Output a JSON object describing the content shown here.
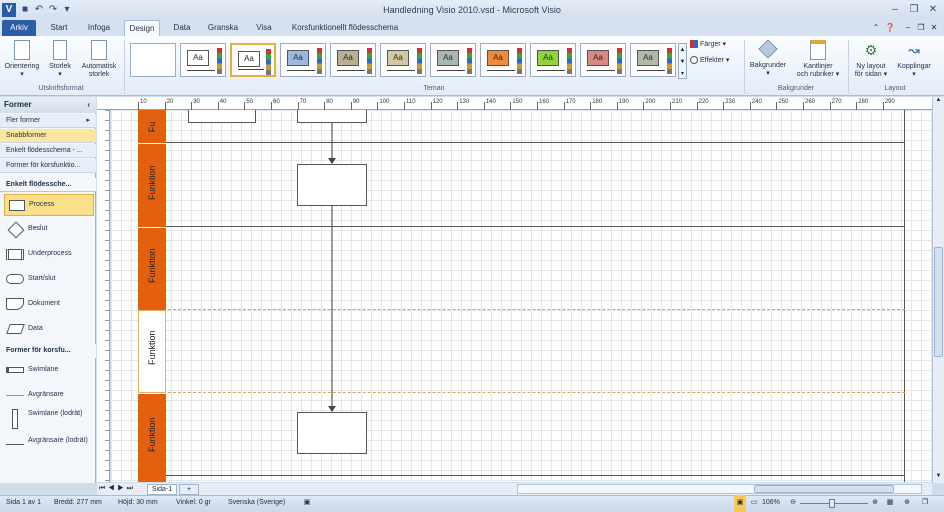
{
  "window": {
    "title": "Handledning Visio 2010.vsd - Microsoft Visio"
  },
  "tabs": [
    {
      "label": "Arkiv"
    },
    {
      "label": "Start"
    },
    {
      "label": "Infoga"
    },
    {
      "label": "Design"
    },
    {
      "label": "Data"
    },
    {
      "label": "Granska"
    },
    {
      "label": "Visa"
    },
    {
      "label": "Korsfunktionellt flödesschema"
    }
  ],
  "ribbon": {
    "page_setup": {
      "orientation": "Orientering",
      "size": "Storlek",
      "auto_size_1": "Automatisk",
      "auto_size_2": "storlek",
      "group": "Utskriftsformat"
    },
    "themes": {
      "group": "Teman",
      "colors": "Färger",
      "effects": "Effekter",
      "labels": [
        "Aa",
        "Aa",
        "Aa",
        "Aa",
        "Aa",
        "Aa",
        "Aa",
        "Aa",
        "Aa",
        "Aa",
        "Aa"
      ]
    },
    "backgrounds": {
      "bg": "Bakgrunder",
      "borders_1": "Kantlinjer",
      "borders_2": "och rubriker",
      "group": "Bakgrunder"
    },
    "layout": {
      "relayout_1": "Ny layout",
      "relayout_2": "för sidan",
      "connectors": "Kopplingar",
      "group": "Layout"
    }
  },
  "panel": {
    "title": "Former",
    "items": [
      "Fler former",
      "Snabbformer",
      "Enkelt flödesschema - ...",
      "Former för korsfunktio...",
      "Enkelt flödessche..."
    ],
    "shapes": [
      "Process",
      "Beslut",
      "Underprocess",
      "Start/slut",
      "Dokument",
      "Data"
    ],
    "section2": "Former för korsfu...",
    "shapes2": [
      "Swimlane",
      "Avgränsare",
      "Swimlane (lodrät)",
      "Avgränsare (lodrät)"
    ]
  },
  "ruler_ticks": [
    "10",
    "20",
    "30",
    "40",
    "50",
    "60",
    "70",
    "80",
    "90",
    "100",
    "110",
    "120",
    "130",
    "140",
    "150",
    "160",
    "170",
    "180",
    "190",
    "200",
    "210",
    "220",
    "230",
    "240",
    "250",
    "260",
    "270",
    "280",
    "290"
  ],
  "lanes": [
    {
      "label": "Fu"
    },
    {
      "label": "Funktion"
    },
    {
      "label": "Funktion"
    },
    {
      "label": "Funktion"
    },
    {
      "label": "Funktion"
    }
  ],
  "page_tab": "Sida-1",
  "status": {
    "page": "Sida 1 av 1",
    "width": "Bredd: 277 mm",
    "height": "Höjd: 30 mm",
    "angle": "Vinkel: 0 gr",
    "language": "Svenska (Sverige)",
    "zoom": "106%"
  }
}
